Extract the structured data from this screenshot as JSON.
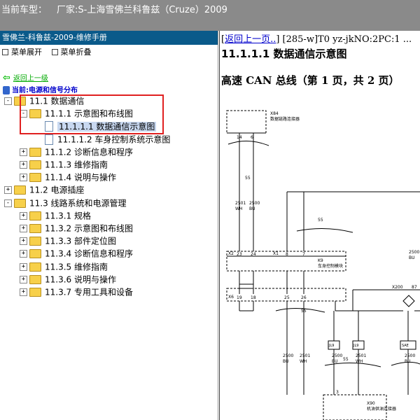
{
  "titlebar": {
    "car_label": "当前车型：",
    "car_value": "厂家:S-上海雪佛兰科鲁兹（Cruze）2009"
  },
  "left_panel": {
    "header": "雪佛兰-科鲁兹-2009-维修手册",
    "expand_all": "菜单展开",
    "collapse_all": "菜单折叠",
    "back_link": "返回上一级",
    "current": "当前:电源和信号分布"
  },
  "tree": [
    {
      "label": "11.1 数据通信",
      "toggle": "-",
      "icon": "folder-open-icon"
    },
    {
      "label": "11.1.1 示意图和布线图",
      "toggle": "-",
      "icon": "folder-open-icon"
    },
    {
      "label": "11.1.1.1 数据通信示意图",
      "toggle": "",
      "icon": "document-icon",
      "selected": true
    },
    {
      "label": "11.1.1.2 车身控制系统示意图",
      "toggle": "",
      "icon": "document-icon"
    },
    {
      "label": "11.1.2 诊断信息和程序",
      "toggle": "+",
      "icon": "folder-icon"
    },
    {
      "label": "11.1.3 维修指南",
      "toggle": "+",
      "icon": "folder-icon"
    },
    {
      "label": "11.1.4 说明与操作",
      "toggle": "+",
      "icon": "folder-icon"
    },
    {
      "label": "11.2 电源插座",
      "toggle": "+",
      "icon": "folder-icon"
    },
    {
      "label": "11.3 线路系统和电源管理",
      "toggle": "-",
      "icon": "folder-open-icon"
    },
    {
      "label": "11.3.1 规格",
      "toggle": "+",
      "icon": "folder-icon"
    },
    {
      "label": "11.3.2 示意图和布线图",
      "toggle": "+",
      "icon": "folder-icon"
    },
    {
      "label": "11.3.3 部件定位图",
      "toggle": "+",
      "icon": "folder-icon"
    },
    {
      "label": "11.3.4 诊断信息和程序",
      "toggle": "+",
      "icon": "folder-icon"
    },
    {
      "label": "11.3.5 维修指南",
      "toggle": "+",
      "icon": "folder-icon"
    },
    {
      "label": "11.3.6 说明与操作",
      "toggle": "+",
      "icon": "folder-icon"
    },
    {
      "label": "11.3.7 专用工具和设备",
      "toggle": "+",
      "icon": "folder-icon"
    }
  ],
  "right_panel": {
    "nav_prefix": "[",
    "nav_link": "返回上一页..",
    "nav_suffix": "] [285-w]T0 yz-jkNO:2PC:1 ...",
    "doc_title": "11.1.1.1 数据通信示意图",
    "bus_title": "高速 CAN 总线（第 1 页，共 2 页）"
  },
  "diagram": {
    "x84": "X84",
    "x84_name": "数据链路连接器",
    "x84_pin_a": "14",
    "x84_pin_b": "6",
    "wire_2501": "2501",
    "wire_2500": "2500",
    "wh": "WH",
    "bu": "BU",
    "k9_x2": "X2",
    "k9_x1": "X1",
    "k9": "K9",
    "k9_name": "车身控制模块",
    "pin_23": "23",
    "pin_24": "24",
    "pin_8": "8",
    "pin_7": "7",
    "x6": "X6",
    "pin_19": "19",
    "pin_18": "18",
    "pin_25": "25",
    "pin_26": "26",
    "x200": "X200",
    "pin_87": "87",
    "shield_55": "55",
    "jl9": "JL9",
    "sae": "SAE",
    "x90": "X90",
    "x90_name": "机油供油连接器",
    "pin_3": "3"
  }
}
